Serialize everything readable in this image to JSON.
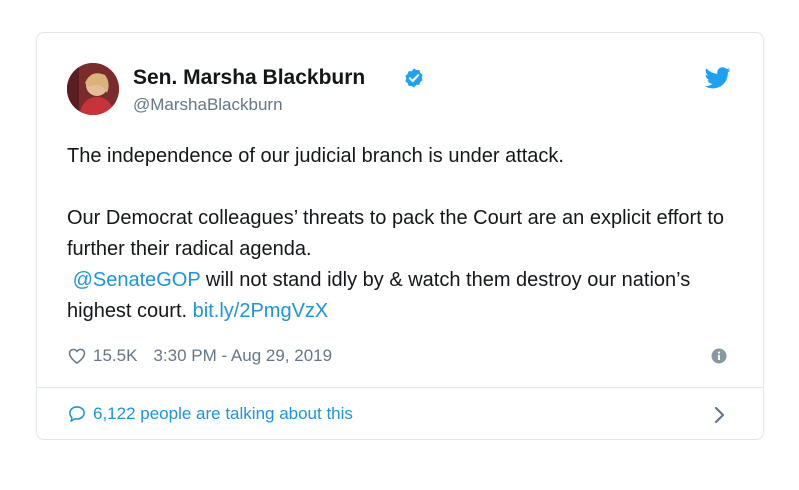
{
  "tweet": {
    "author_name": "Sen. Marsha Blackburn",
    "handle": "@MarshaBlackburn",
    "line1": "The independence of our judicial branch is under attack.",
    "line2": "Our Democrat colleagues’ threats to pack the Court are an explicit effort to further their radical agenda.",
    "mention": "@SenateGOP",
    "line3_rest": " will not stand idly by & watch them destroy our nation’s highest court.",
    "link": "bit.ly/2PmgVzX",
    "likes": "15.5K",
    "timestamp": "3:30 PM - Aug 29, 2019",
    "talking": "6,122 people are talking about this"
  },
  "icons": {
    "verified": "verified-badge-icon",
    "brand": "twitter-bird-icon",
    "like": "heart-icon",
    "info": "info-icon",
    "reply": "speech-bubble-icon",
    "next": "chevron-right-icon"
  },
  "colors": {
    "accent": "#1b95e0",
    "text": "#14171a",
    "muted": "#657786",
    "border": "#e1e8ed"
  }
}
